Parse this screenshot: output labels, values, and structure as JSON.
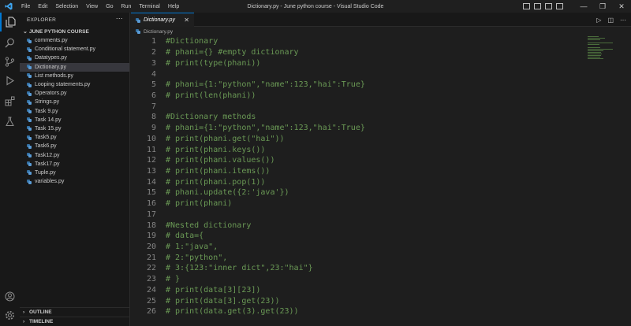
{
  "titlebar": {
    "menu": [
      "File",
      "Edit",
      "Selection",
      "View",
      "Go",
      "Run",
      "Terminal",
      "Help"
    ],
    "window_title": "Dictionary.py - June python course - Visual Studio Code"
  },
  "sidebar": {
    "header": "EXPLORER",
    "folder": "JUNE PYTHON COURSE",
    "files": [
      "comments.py",
      "Conditional statement.py",
      "Datatypes.py",
      "Dictionary.py",
      "List methods.py",
      "Looping statements.py",
      "Operators.py",
      "Strings.py",
      "Task 9.py",
      "Task 14.py",
      "Task 15.py",
      "Task5.py",
      "Task6.py",
      "Task12.py",
      "Task17.py",
      "Tuple.py",
      "variables.py"
    ],
    "selected_index": 3,
    "outline": "OUTLINE",
    "timeline": "TIMELINE"
  },
  "editor": {
    "tab": "Dictionary.py",
    "breadcrumb": "Dictionary.py",
    "lines": [
      {
        "n": "1",
        "t": "#Dictionary"
      },
      {
        "n": "2",
        "t": "# phani={} #empty dictionary"
      },
      {
        "n": "3",
        "t": "# print(type(phani))"
      },
      {
        "n": "4",
        "t": ""
      },
      {
        "n": "5",
        "t": "# phani={1:\"python\",\"name\":123,\"hai\":True}"
      },
      {
        "n": "6",
        "t": "# print(len(phani))"
      },
      {
        "n": "7",
        "t": ""
      },
      {
        "n": "8",
        "t": "#Dictionary methods"
      },
      {
        "n": "9",
        "t": "# phani={1:\"python\",\"name\":123,\"hai\":True}"
      },
      {
        "n": "10",
        "t": "# print(phani.get(\"hai\"))"
      },
      {
        "n": "11",
        "t": "# print(phani.keys())"
      },
      {
        "n": "12",
        "t": "# print(phani.values())"
      },
      {
        "n": "13",
        "t": "# print(phani.items())"
      },
      {
        "n": "14",
        "t": "# print(phani.pop(1))"
      },
      {
        "n": "15",
        "t": "# phani.update({2:'java'})"
      },
      {
        "n": "16",
        "t": "# print(phani)"
      },
      {
        "n": "17",
        "t": ""
      },
      {
        "n": "18",
        "t": "#Nested dictionary"
      },
      {
        "n": "19",
        "t": "# data={"
      },
      {
        "n": "20",
        "t": "# 1:\"java\","
      },
      {
        "n": "21",
        "t": "# 2:\"python\","
      },
      {
        "n": "22",
        "t": "# 3:{123:\"inner dict\",23:\"hai\"}"
      },
      {
        "n": "23",
        "t": "# }"
      },
      {
        "n": "24",
        "t": "# print(data[3][23])"
      },
      {
        "n": "25",
        "t": "# print(data[3].get(23))"
      },
      {
        "n": "26",
        "t": "# print(data.get(3).get(23))"
      }
    ]
  },
  "colors": {
    "accent": "#0078d4",
    "comment": "#6a9955",
    "line_number": "#858585",
    "background": "#1e1e1e"
  }
}
